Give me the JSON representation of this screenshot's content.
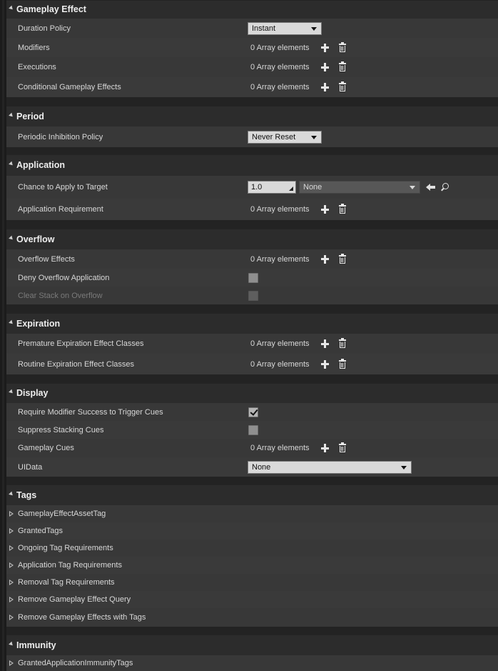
{
  "sections": {
    "gameplay_effect": {
      "title": "Gameplay Effect"
    },
    "period": {
      "title": "Period"
    },
    "application": {
      "title": "Application"
    },
    "overflow": {
      "title": "Overflow"
    },
    "expiration": {
      "title": "Expiration"
    },
    "display": {
      "title": "Display"
    },
    "tags": {
      "title": "Tags"
    },
    "immunity": {
      "title": "Immunity"
    }
  },
  "array_text": "0 Array elements",
  "gameplay_effect": {
    "duration_policy": {
      "label": "Duration Policy",
      "value": "Instant"
    },
    "modifiers": {
      "label": "Modifiers"
    },
    "executions": {
      "label": "Executions"
    },
    "conditional_effects": {
      "label": "Conditional Gameplay Effects"
    }
  },
  "period": {
    "periodic_inhibition": {
      "label": "Periodic Inhibition Policy",
      "value": "Never Reset"
    }
  },
  "application": {
    "chance": {
      "label": "Chance to Apply to Target",
      "value": "1.0",
      "curve": "None"
    },
    "requirement": {
      "label": "Application Requirement"
    }
  },
  "overflow": {
    "effects": {
      "label": "Overflow Effects"
    },
    "deny": {
      "label": "Deny Overflow Application",
      "checked": false
    },
    "clear_stack": {
      "label": "Clear Stack on Overflow",
      "checked": false,
      "disabled": true
    }
  },
  "expiration": {
    "premature": {
      "label": "Premature Expiration Effect Classes"
    },
    "routine": {
      "label": "Routine Expiration Effect Classes"
    }
  },
  "display": {
    "require_modifier": {
      "label": "Require Modifier Success to Trigger Cues",
      "checked": true
    },
    "suppress_stacking": {
      "label": "Suppress Stacking Cues",
      "checked": false
    },
    "gameplay_cues": {
      "label": "Gameplay Cues"
    },
    "uidata": {
      "label": "UIData",
      "value": "None"
    }
  },
  "tags": {
    "items": [
      "GameplayEffectAssetTag",
      "GrantedTags",
      "Ongoing Tag Requirements",
      "Application Tag Requirements",
      "Removal Tag Requirements",
      "Remove Gameplay Effect Query",
      "Remove Gameplay Effects with Tags"
    ]
  },
  "immunity": {
    "items": [
      "GrantedApplicationImmunityTags"
    ]
  },
  "icons": {
    "section_collapse": "triangle-down-icon",
    "expander": "triangle-right-icon",
    "add": "plus-icon",
    "remove": "trash-icon",
    "use_selected": "arrow-left-icon",
    "browse": "search-icon"
  }
}
